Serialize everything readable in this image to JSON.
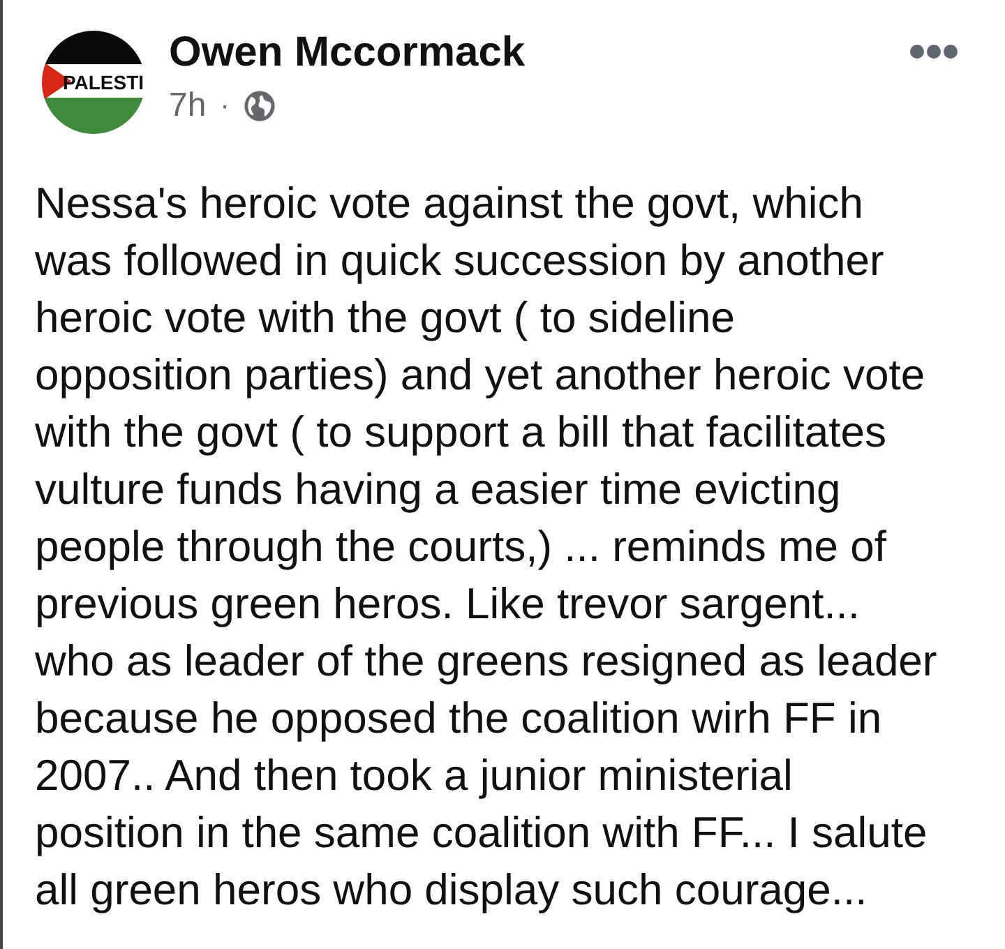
{
  "post": {
    "author": {
      "name": "Owen Mccormack",
      "avatar_label": "PALESTI"
    },
    "time": "7h",
    "separator": "·",
    "body": "Nessa's heroic vote against the govt, which was followed in quick succession by another heroic vote with the govt ( to sideline opposition parties) and yet another heroic vote with the govt ( to support a bill that facilitates vulture funds having a easier time evicting people through the courts,) ... reminds me of previous green heros. Like trevor sargent... who as leader of the greens resigned as leader because he opposed the coalition wirh FF in 2007.. And then took a junior ministerial position in the same coalition with FF... I salute all green heros who display such courage..."
  }
}
